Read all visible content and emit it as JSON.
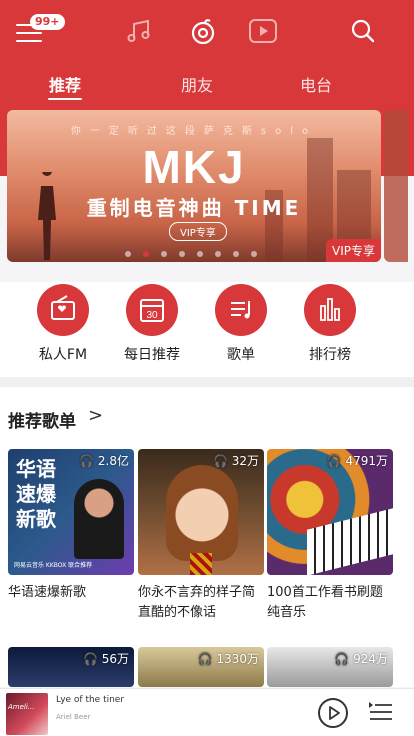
{
  "header": {
    "badge": "99+",
    "icons": [
      "menu-icon",
      "music-note-icon",
      "netease-logo-icon",
      "video-play-icon",
      "search-icon"
    ],
    "tabs": [
      "推荐",
      "朋友",
      "电台"
    ],
    "active_tab": "推荐",
    "colors": {
      "brand": "#d8383a"
    }
  },
  "banner": {
    "subtitle": "你一定听过这段萨克斯solo",
    "headline": "MKJ",
    "line": "重制电音神曲 TIME",
    "pill": "VIP专享",
    "tag": "VIP专享",
    "dots": 8,
    "active_dot": 1
  },
  "quick": [
    {
      "label": "私人FM",
      "icon": "radio-icon"
    },
    {
      "label": "每日推荐",
      "icon": "calendar-icon",
      "icon_text": "30"
    },
    {
      "label": "歌单",
      "icon": "playlist-icon"
    },
    {
      "label": "排行榜",
      "icon": "chart-bars-icon"
    }
  ],
  "playlists": {
    "title": "推荐歌单",
    "arrow": ">",
    "items": [
      {
        "count": "2.8亿",
        "title": "华语速爆新歌",
        "cover_text": "华语\n速爆\n新歌",
        "brand": "网易云音乐 KKBOX 联合推荐"
      },
      {
        "count": "32万",
        "title": "你永不言弃的样子简直酷的不像话"
      },
      {
        "count": "4791万",
        "title": "100首工作看书刷题纯音乐"
      },
      {
        "count": "56万",
        "title": ""
      },
      {
        "count": "1330万",
        "title": ""
      },
      {
        "count": "924万",
        "title": ""
      }
    ]
  },
  "player": {
    "title": "Lye of the tiner",
    "artist": "Ariel Beer",
    "album_art_text": "Ameli..."
  }
}
